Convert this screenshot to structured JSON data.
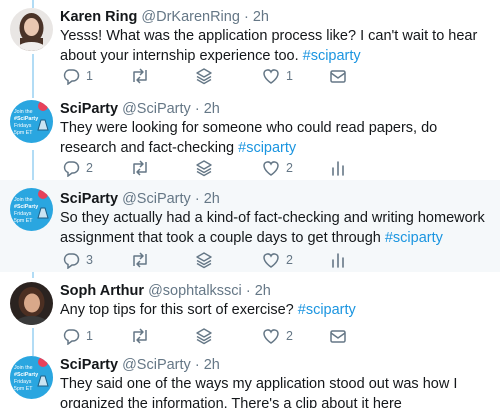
{
  "tweets": [
    {
      "name": "Karen Ring",
      "handle": "@DrKarenRing",
      "separator": "·",
      "time": "2h",
      "text": "Yesss! What was the application process like? I can't wait to hear about your internship experience too.",
      "hashtag": "#sciparty",
      "replies": "1",
      "retweets": "",
      "likes": "1",
      "avatar": "woman-portrait-avatar"
    },
    {
      "name": "SciParty",
      "handle": "@SciParty",
      "separator": "·",
      "time": "2h",
      "text": "They were looking for someone who could read papers, do research and fact-checking",
      "hashtag": "#sciparty",
      "replies": "2",
      "retweets": "",
      "likes": "2",
      "avatar": "sciparty-logo-avatar",
      "avatar_text": [
        "Join the",
        "#SciParty",
        "Fridays",
        "5pm ET"
      ]
    },
    {
      "name": "SciParty",
      "handle": "@SciParty",
      "separator": "·",
      "time": "2h",
      "text": "So they actually had a kind-of fact-checking and writing homework assignment that took a couple days to get through",
      "hashtag": "#sciparty",
      "replies": "3",
      "retweets": "",
      "likes": "2",
      "avatar": "sciparty-logo-avatar",
      "avatar_text": [
        "Join the",
        "#SciParty",
        "Fridays",
        "5pm ET"
      ]
    },
    {
      "name": "Soph Arthur",
      "handle": "@sophtalkssci",
      "separator": "·",
      "time": "2h",
      "text": "Any top tips for this sort of exercise?",
      "hashtag": "#sciparty",
      "replies": "1",
      "retweets": "",
      "likes": "2",
      "avatar": "person-portrait-avatar"
    },
    {
      "name": "SciParty",
      "handle": "@SciParty",
      "separator": "·",
      "time": "2h",
      "text": "They said one of the ways my application stood out was how I organized the information. There's a clip about it here",
      "hashtag": "",
      "avatar": "sciparty-logo-avatar",
      "avatar_text": [
        "Join the",
        "#SciParty",
        "Fridays",
        "5pm ET"
      ]
    }
  ],
  "colors": {
    "hashtag": "#1b95e0",
    "muted": "#657786",
    "thread_line": "#b2dcf5",
    "highlight_bg": "#f5f8fa"
  }
}
